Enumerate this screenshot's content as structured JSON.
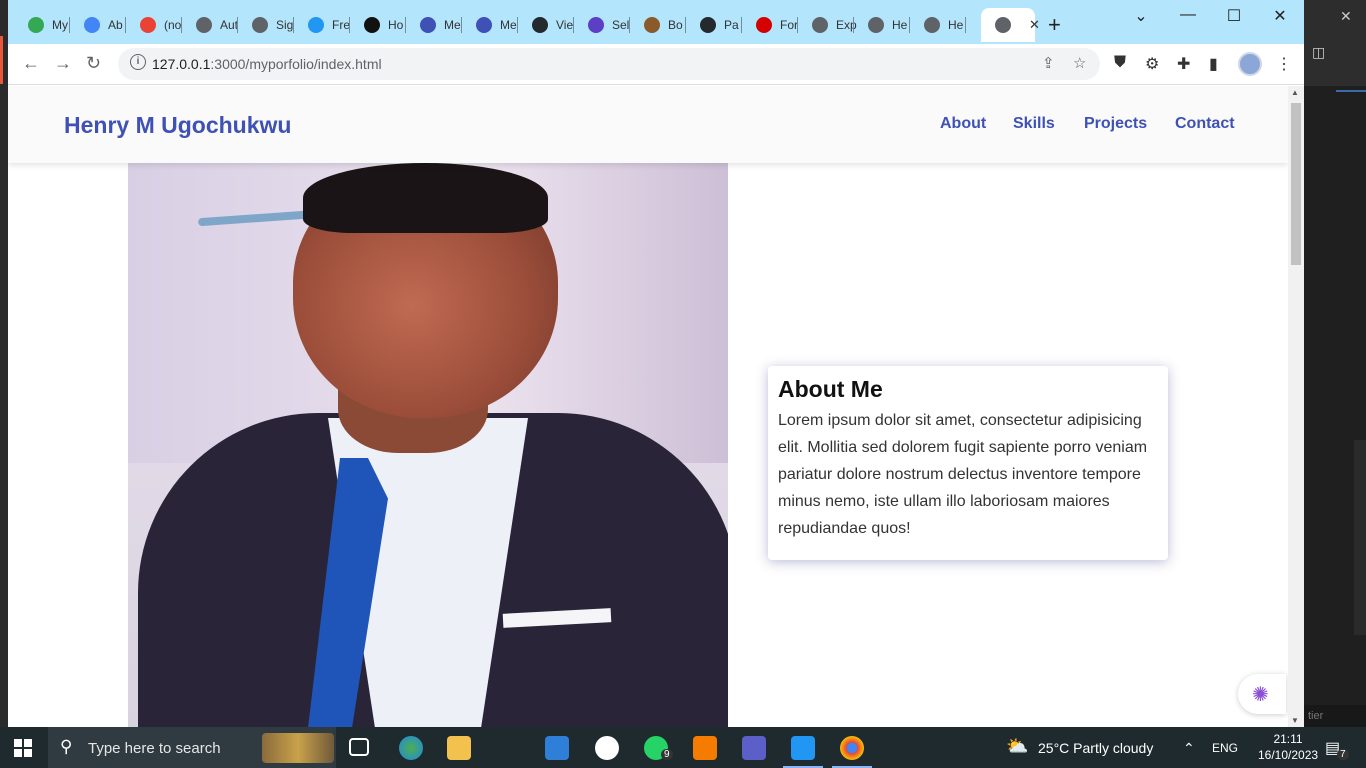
{
  "browser": {
    "tabs": [
      {
        "label": "My",
        "color": "#34a853"
      },
      {
        "label": "Ab",
        "color": "#4285f4"
      },
      {
        "label": "(no",
        "color": "#ea4335"
      },
      {
        "label": "Aut",
        "color": "#5f6368"
      },
      {
        "label": "Sig",
        "color": "#5f6368"
      },
      {
        "label": "Fre",
        "color": "#2196f3"
      },
      {
        "label": "Ho",
        "color": "#111111"
      },
      {
        "label": "Me",
        "color": "#3f51b5"
      },
      {
        "label": "Me",
        "color": "#3f51b5"
      },
      {
        "label": "Vie",
        "color": "#24292e"
      },
      {
        "label": "Sel",
        "color": "#5c3fc4"
      },
      {
        "label": "Bo",
        "color": "#8b5a2b"
      },
      {
        "label": "Pa",
        "color": "#24292e"
      },
      {
        "label": "For",
        "color": "#d50000"
      },
      {
        "label": "Exp",
        "color": "#5f6368"
      },
      {
        "label": "He",
        "color": "#5f6368"
      },
      {
        "label": "He",
        "color": "#5f6368"
      }
    ],
    "url_host": "127.0.0.1",
    "url_path": ":3000/myporfolio/index.html"
  },
  "site": {
    "brand": "Henry M Ugochukwu",
    "nav": [
      "About",
      "Skills",
      "Projects",
      "Contact"
    ],
    "about_title": "About Me",
    "about_text": "Lorem ipsum dolor sit amet, consectetur adipisicing elit. Mollitia sed dolorem fugit sapiente porro veniam pariatur dolore nostrum delectus inventore tempore minus nemo, iste ullam illo laboriosam maiores repudiandae quos!",
    "accent": "#3f51b5"
  },
  "background_app": {
    "status_text": "tier"
  },
  "taskbar": {
    "search_placeholder": "Type here to search",
    "whatsapp_badge": "9",
    "weather": "25°C  Partly cloudy",
    "language": "ENG",
    "time": "21:11",
    "date": "16/10/2023",
    "notifications": "7"
  }
}
